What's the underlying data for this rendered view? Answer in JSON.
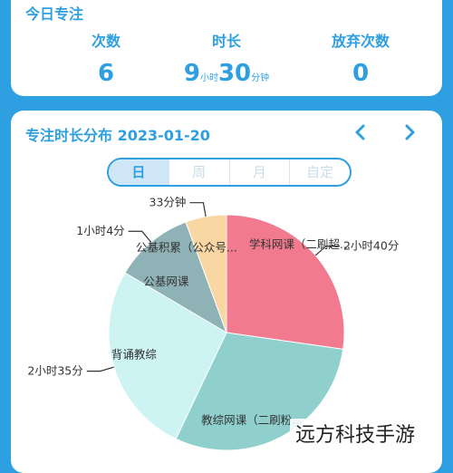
{
  "summary": {
    "title": "今日专注",
    "count_label": "次数",
    "count_value": "6",
    "duration_label": "时长",
    "duration_hours": "9",
    "duration_hours_unit": "小时",
    "duration_minutes": "30",
    "duration_minutes_unit": "分钟",
    "abandon_label": "放弃次数",
    "abandon_value": "0"
  },
  "chart_section": {
    "title": "专注时长分布 2023-01-20",
    "prev_icon": "chevron-left-icon",
    "next_icon": "chevron-right-icon",
    "tabs": [
      {
        "label": "日",
        "active": true
      },
      {
        "label": "周",
        "active": false
      },
      {
        "label": "月",
        "active": false
      },
      {
        "label": "自定",
        "active": false
      }
    ]
  },
  "chart_data": {
    "type": "pie",
    "slices": [
      {
        "name": "学科网课（二刷超...",
        "duration": "2小时40分",
        "minutes": 160,
        "color": "#f27a8e"
      },
      {
        "name": "教综网课（二刷粉...",
        "duration": "",
        "minutes": 175,
        "color": "#8fd0cd"
      },
      {
        "name": "背诵教综",
        "duration": "2小时35分",
        "minutes": 155,
        "color": "#cdf3f3"
      },
      {
        "name": "公基网课",
        "duration": "1小时4分",
        "minutes": 64,
        "color": "#8fb2b6"
      },
      {
        "name": "公基积累（公众号...",
        "duration": "33分钟",
        "minutes": 33,
        "color": "#f9d7a3"
      }
    ],
    "colors": {
      "accent": "#2e9fe0",
      "background": "#2e9fe0"
    }
  },
  "watermark": "远方科技手游"
}
